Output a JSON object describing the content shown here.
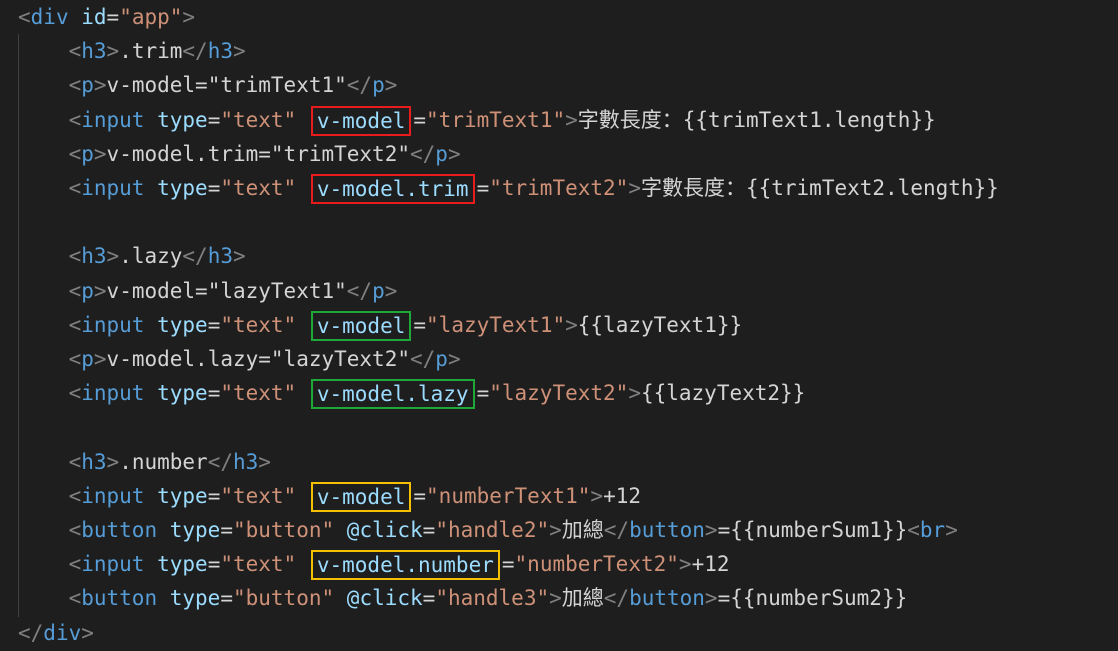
{
  "editor": {
    "lines": [
      [
        {
          "t": "<",
          "c": "bracket"
        },
        {
          "t": "div",
          "c": "tag"
        },
        {
          "t": " ",
          "c": "txt"
        },
        {
          "t": "id",
          "c": "attr"
        },
        {
          "t": "=",
          "c": "txt"
        },
        {
          "t": "\"app\"",
          "c": "str"
        },
        {
          "t": ">",
          "c": "bracket"
        }
      ],
      [
        {
          "t": "    ",
          "c": "txt"
        },
        {
          "t": "<",
          "c": "bracket"
        },
        {
          "t": "h3",
          "c": "tag"
        },
        {
          "t": ">",
          "c": "bracket"
        },
        {
          "t": ".trim",
          "c": "txt"
        },
        {
          "t": "</",
          "c": "bracket"
        },
        {
          "t": "h3",
          "c": "tag"
        },
        {
          "t": ">",
          "c": "bracket"
        }
      ],
      [
        {
          "t": "    ",
          "c": "txt"
        },
        {
          "t": "<",
          "c": "bracket"
        },
        {
          "t": "p",
          "c": "tag"
        },
        {
          "t": ">",
          "c": "bracket"
        },
        {
          "t": "v-model=\"trimText1\"",
          "c": "txt"
        },
        {
          "t": "</",
          "c": "bracket"
        },
        {
          "t": "p",
          "c": "tag"
        },
        {
          "t": ">",
          "c": "bracket"
        }
      ],
      [
        {
          "t": "    ",
          "c": "txt"
        },
        {
          "t": "<",
          "c": "bracket"
        },
        {
          "t": "input",
          "c": "tag"
        },
        {
          "t": " ",
          "c": "txt"
        },
        {
          "t": "type",
          "c": "attr"
        },
        {
          "t": "=",
          "c": "txt"
        },
        {
          "t": "\"text\"",
          "c": "str"
        },
        {
          "t": " ",
          "c": "txt"
        },
        {
          "t": "v-model",
          "c": "attr",
          "hl": "red"
        },
        {
          "t": "=",
          "c": "txt"
        },
        {
          "t": "\"trimText1\"",
          "c": "str"
        },
        {
          "t": ">",
          "c": "bracket"
        },
        {
          "t": "字數長度：{{trimText1.length}}",
          "c": "txt"
        }
      ],
      [
        {
          "t": "    ",
          "c": "txt"
        },
        {
          "t": "<",
          "c": "bracket"
        },
        {
          "t": "p",
          "c": "tag"
        },
        {
          "t": ">",
          "c": "bracket"
        },
        {
          "t": "v-model.trim=\"trimText2\"",
          "c": "txt"
        },
        {
          "t": "</",
          "c": "bracket"
        },
        {
          "t": "p",
          "c": "tag"
        },
        {
          "t": ">",
          "c": "bracket"
        }
      ],
      [
        {
          "t": "    ",
          "c": "txt"
        },
        {
          "t": "<",
          "c": "bracket"
        },
        {
          "t": "input",
          "c": "tag"
        },
        {
          "t": " ",
          "c": "txt"
        },
        {
          "t": "type",
          "c": "attr"
        },
        {
          "t": "=",
          "c": "txt"
        },
        {
          "t": "\"text\"",
          "c": "str"
        },
        {
          "t": " ",
          "c": "txt"
        },
        {
          "t": "v-model.trim",
          "c": "attr",
          "hl": "red"
        },
        {
          "t": "=",
          "c": "txt"
        },
        {
          "t": "\"trimText2\"",
          "c": "str"
        },
        {
          "t": ">",
          "c": "bracket"
        },
        {
          "t": "字數長度：{{trimText2.length}}",
          "c": "txt"
        }
      ],
      [],
      [
        {
          "t": "    ",
          "c": "txt"
        },
        {
          "t": "<",
          "c": "bracket"
        },
        {
          "t": "h3",
          "c": "tag"
        },
        {
          "t": ">",
          "c": "bracket"
        },
        {
          "t": ".lazy",
          "c": "txt"
        },
        {
          "t": "</",
          "c": "bracket"
        },
        {
          "t": "h3",
          "c": "tag"
        },
        {
          "t": ">",
          "c": "bracket"
        }
      ],
      [
        {
          "t": "    ",
          "c": "txt"
        },
        {
          "t": "<",
          "c": "bracket"
        },
        {
          "t": "p",
          "c": "tag"
        },
        {
          "t": ">",
          "c": "bracket"
        },
        {
          "t": "v-model=\"lazyText1\"",
          "c": "txt"
        },
        {
          "t": "</",
          "c": "bracket"
        },
        {
          "t": "p",
          "c": "tag"
        },
        {
          "t": ">",
          "c": "bracket"
        }
      ],
      [
        {
          "t": "    ",
          "c": "txt"
        },
        {
          "t": "<",
          "c": "bracket"
        },
        {
          "t": "input",
          "c": "tag"
        },
        {
          "t": " ",
          "c": "txt"
        },
        {
          "t": "type",
          "c": "attr"
        },
        {
          "t": "=",
          "c": "txt"
        },
        {
          "t": "\"text\"",
          "c": "str"
        },
        {
          "t": " ",
          "c": "txt"
        },
        {
          "t": "v-model",
          "c": "attr",
          "hl": "green"
        },
        {
          "t": "=",
          "c": "txt"
        },
        {
          "t": "\"lazyText1\"",
          "c": "str"
        },
        {
          "t": ">",
          "c": "bracket"
        },
        {
          "t": "{{lazyText1}}",
          "c": "txt"
        }
      ],
      [
        {
          "t": "    ",
          "c": "txt"
        },
        {
          "t": "<",
          "c": "bracket"
        },
        {
          "t": "p",
          "c": "tag"
        },
        {
          "t": ">",
          "c": "bracket"
        },
        {
          "t": "v-model.lazy=\"lazyText2\"",
          "c": "txt"
        },
        {
          "t": "</",
          "c": "bracket"
        },
        {
          "t": "p",
          "c": "tag"
        },
        {
          "t": ">",
          "c": "bracket"
        }
      ],
      [
        {
          "t": "    ",
          "c": "txt"
        },
        {
          "t": "<",
          "c": "bracket"
        },
        {
          "t": "input",
          "c": "tag"
        },
        {
          "t": " ",
          "c": "txt"
        },
        {
          "t": "type",
          "c": "attr"
        },
        {
          "t": "=",
          "c": "txt"
        },
        {
          "t": "\"text\"",
          "c": "str"
        },
        {
          "t": " ",
          "c": "txt"
        },
        {
          "t": "v-model.lazy",
          "c": "attr",
          "hl": "green"
        },
        {
          "t": "=",
          "c": "txt"
        },
        {
          "t": "\"lazyText2\"",
          "c": "str"
        },
        {
          "t": ">",
          "c": "bracket"
        },
        {
          "t": "{{lazyText2}}",
          "c": "txt"
        }
      ],
      [],
      [
        {
          "t": "    ",
          "c": "txt"
        },
        {
          "t": "<",
          "c": "bracket"
        },
        {
          "t": "h3",
          "c": "tag"
        },
        {
          "t": ">",
          "c": "bracket"
        },
        {
          "t": ".number",
          "c": "txt"
        },
        {
          "t": "</",
          "c": "bracket"
        },
        {
          "t": "h3",
          "c": "tag"
        },
        {
          "t": ">",
          "c": "bracket"
        }
      ],
      [
        {
          "t": "    ",
          "c": "txt"
        },
        {
          "t": "<",
          "c": "bracket"
        },
        {
          "t": "input",
          "c": "tag"
        },
        {
          "t": " ",
          "c": "txt"
        },
        {
          "t": "type",
          "c": "attr"
        },
        {
          "t": "=",
          "c": "txt"
        },
        {
          "t": "\"text\"",
          "c": "str"
        },
        {
          "t": " ",
          "c": "txt"
        },
        {
          "t": "v-model",
          "c": "attr",
          "hl": "yellow"
        },
        {
          "t": "=",
          "c": "txt"
        },
        {
          "t": "\"numberText1\"",
          "c": "str"
        },
        {
          "t": ">",
          "c": "bracket"
        },
        {
          "t": "+12",
          "c": "txt"
        }
      ],
      [
        {
          "t": "    ",
          "c": "txt"
        },
        {
          "t": "<",
          "c": "bracket"
        },
        {
          "t": "button",
          "c": "tag"
        },
        {
          "t": " ",
          "c": "txt"
        },
        {
          "t": "type",
          "c": "attr"
        },
        {
          "t": "=",
          "c": "txt"
        },
        {
          "t": "\"button\"",
          "c": "str"
        },
        {
          "t": " ",
          "c": "txt"
        },
        {
          "t": "@click",
          "c": "attr"
        },
        {
          "t": "=",
          "c": "txt"
        },
        {
          "t": "\"handle2\"",
          "c": "str"
        },
        {
          "t": ">",
          "c": "bracket"
        },
        {
          "t": "加總",
          "c": "txt"
        },
        {
          "t": "</",
          "c": "bracket"
        },
        {
          "t": "button",
          "c": "tag"
        },
        {
          "t": ">",
          "c": "bracket"
        },
        {
          "t": "={{numberSum1}}",
          "c": "txt"
        },
        {
          "t": "<",
          "c": "bracket"
        },
        {
          "t": "br",
          "c": "tag"
        },
        {
          "t": ">",
          "c": "bracket"
        }
      ],
      [
        {
          "t": "    ",
          "c": "txt"
        },
        {
          "t": "<",
          "c": "bracket"
        },
        {
          "t": "input",
          "c": "tag"
        },
        {
          "t": " ",
          "c": "txt"
        },
        {
          "t": "type",
          "c": "attr"
        },
        {
          "t": "=",
          "c": "txt"
        },
        {
          "t": "\"text\"",
          "c": "str"
        },
        {
          "t": " ",
          "c": "txt"
        },
        {
          "t": "v-model.number",
          "c": "attr",
          "hl": "yellow"
        },
        {
          "t": "=",
          "c": "txt"
        },
        {
          "t": "\"numberText2\"",
          "c": "str"
        },
        {
          "t": ">",
          "c": "bracket"
        },
        {
          "t": "+12",
          "c": "txt"
        }
      ],
      [
        {
          "t": "    ",
          "c": "txt"
        },
        {
          "t": "<",
          "c": "bracket"
        },
        {
          "t": "button",
          "c": "tag"
        },
        {
          "t": " ",
          "c": "txt"
        },
        {
          "t": "type",
          "c": "attr"
        },
        {
          "t": "=",
          "c": "txt"
        },
        {
          "t": "\"button\"",
          "c": "str"
        },
        {
          "t": " ",
          "c": "txt"
        },
        {
          "t": "@click",
          "c": "attr"
        },
        {
          "t": "=",
          "c": "txt"
        },
        {
          "t": "\"handle3\"",
          "c": "str"
        },
        {
          "t": ">",
          "c": "bracket"
        },
        {
          "t": "加總",
          "c": "txt"
        },
        {
          "t": "</",
          "c": "bracket"
        },
        {
          "t": "button",
          "c": "tag"
        },
        {
          "t": ">",
          "c": "bracket"
        },
        {
          "t": "={{numberSum2}}",
          "c": "txt"
        }
      ],
      [
        {
          "t": "</",
          "c": "bracket"
        },
        {
          "t": "div",
          "c": "tag"
        },
        {
          "t": ">",
          "c": "bracket"
        }
      ]
    ]
  },
  "colors": {
    "background": "#1e1e1e",
    "tag": "#569cd6",
    "attribute": "#9cdcfe",
    "string": "#ce9178",
    "text": "#d4d4d4",
    "bracket": "#808080",
    "highlight_red": "#e81c1c",
    "highlight_green": "#1fa83a",
    "highlight_yellow": "#f5c000"
  }
}
